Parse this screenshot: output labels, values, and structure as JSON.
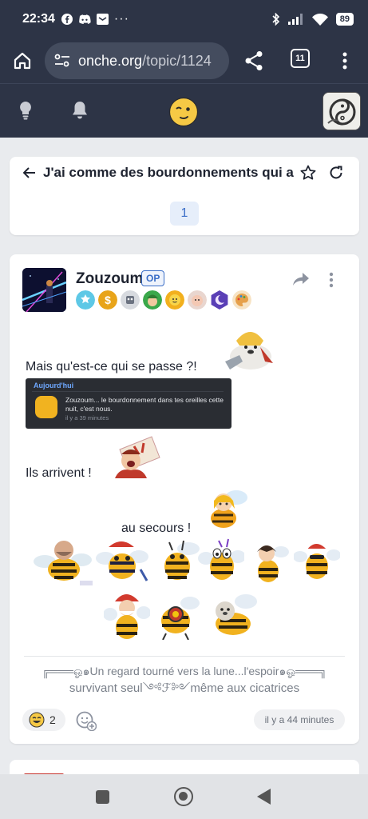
{
  "status_bar": {
    "time": "22:34",
    "battery": "89",
    "left_icons": [
      "facebook-icon",
      "discord-icon",
      "mailbox-icon",
      "more-dots-icon"
    ],
    "right_icons": [
      "bluetooth-icon",
      "signal-icon",
      "wifi-icon",
      "battery-icon"
    ]
  },
  "browser": {
    "url_domain": "onche.org",
    "url_path": "/topic/1124",
    "tab_count": "11"
  },
  "topic": {
    "title": "J'ai comme des bourdonnements qui a",
    "current_page": "1"
  },
  "post": {
    "author": "Zouzoum",
    "op_label": "OP",
    "line1": "Mais qu'est-ce qui se passe ?!",
    "embedded_notification": {
      "header": "Aujourd'hui",
      "text": "Zouzoum... le bourdonnement dans tes oreilles cette nuit, c'est nous.",
      "time": "il y a 39 minutes"
    },
    "line2": "Ils arrivent !",
    "line3": "au secours !",
    "signature_line1": "╔═══ஓ๑Un regard tourné vers la lune...l'espoir๑ஓ═══╗",
    "signature_line2": "survivant seul༺ℱ༻même aux cicatrices",
    "reaction_count": "2",
    "timestamp": "il y a 44 minutes"
  },
  "colors": {
    "header_bg": "#2d3446",
    "accent": "#3a6ec7",
    "page_bg": "#e9ebee"
  }
}
